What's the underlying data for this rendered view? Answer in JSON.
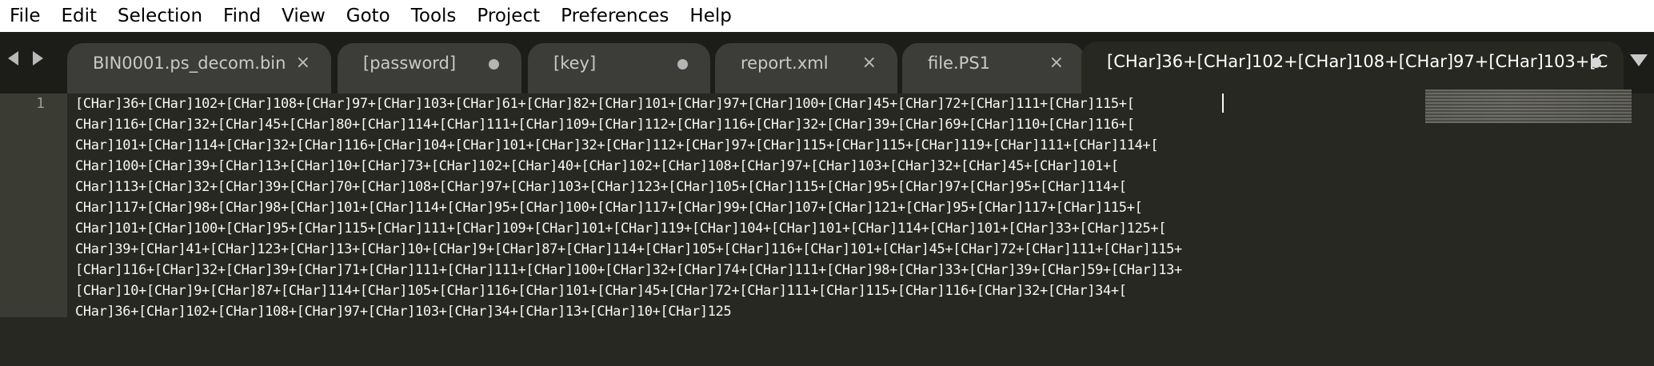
{
  "menu": [
    "File",
    "Edit",
    "Selection",
    "Find",
    "View",
    "Goto",
    "Tools",
    "Project",
    "Preferences",
    "Help"
  ],
  "tabs": [
    {
      "label": "BIN0001.ps_decom.bin",
      "indicator": "close",
      "close_glyph": "×",
      "active": false
    },
    {
      "label": "[password]",
      "indicator": "modified",
      "active": false
    },
    {
      "label": "[key]",
      "indicator": "modified",
      "active": false
    },
    {
      "label": "report.xml",
      "indicator": "close",
      "close_glyph": "×",
      "active": false
    },
    {
      "label": "file.PS1",
      "indicator": "close",
      "close_glyph": "×",
      "active": false
    },
    {
      "label": "[CHar]36+[CHar]102+[CHar]108+[CHar]97+[CHar]103+[C",
      "indicator": "modified",
      "active": true
    }
  ],
  "editor": {
    "line_number": "1",
    "lines": [
      "[CHar]36+[CHar]102+[CHar]108+[CHar]97+[CHar]103+[CHar]61+[CHar]82+[CHar]101+[CHar]97+[CHar]100+[CHar]45+[CHar]72+[CHar]111+[CHar]115+[",
      "CHar]116+[CHar]32+[CHar]45+[CHar]80+[CHar]114+[CHar]111+[CHar]109+[CHar]112+[CHar]116+[CHar]32+[CHar]39+[CHar]69+[CHar]110+[CHar]116+[",
      "CHar]101+[CHar]114+[CHar]32+[CHar]116+[CHar]104+[CHar]101+[CHar]32+[CHar]112+[CHar]97+[CHar]115+[CHar]115+[CHar]119+[CHar]111+[CHar]114+[",
      "CHar]100+[CHar]39+[CHar]13+[CHar]10+[CHar]73+[CHar]102+[CHar]40+[CHar]102+[CHar]108+[CHar]97+[CHar]103+[CHar]32+[CHar]45+[CHar]101+[",
      "CHar]113+[CHar]32+[CHar]39+[CHar]70+[CHar]108+[CHar]97+[CHar]103+[CHar]123+[CHar]105+[CHar]115+[CHar]95+[CHar]97+[CHar]95+[CHar]114+[",
      "CHar]117+[CHar]98+[CHar]98+[CHar]101+[CHar]114+[CHar]95+[CHar]100+[CHar]117+[CHar]99+[CHar]107+[CHar]121+[CHar]95+[CHar]117+[CHar]115+[",
      "CHar]101+[CHar]100+[CHar]95+[CHar]115+[CHar]111+[CHar]109+[CHar]101+[CHar]119+[CHar]104+[CHar]101+[CHar]114+[CHar]101+[CHar]33+[CHar]125+[",
      "CHar]39+[CHar]41+[CHar]123+[CHar]13+[CHar]10+[CHar]9+[CHar]87+[CHar]114+[CHar]105+[CHar]116+[CHar]101+[CHar]45+[CHar]72+[CHar]111+[CHar]115+",
      "[CHar]116+[CHar]32+[CHar]39+[CHar]71+[CHar]111+[CHar]111+[CHar]100+[CHar]32+[CHar]74+[CHar]111+[CHar]98+[CHar]33+[CHar]39+[CHar]59+[CHar]13+",
      "[CHar]10+[CHar]9+[CHar]87+[CHar]114+[CHar]105+[CHar]116+[CHar]101+[CHar]45+[CHar]72+[CHar]111+[CHar]115+[CHar]116+[CHar]32+[CHar]34+[",
      "CHar]36+[CHar]102+[CHar]108+[CHar]97+[CHar]103+[CHar]34+[CHar]13+[CHar]10+[CHar]125"
    ]
  },
  "icons": {
    "nav_left": "chevron-left-icon",
    "nav_right": "chevron-right-icon",
    "tab_overflow": "chevron-down-icon",
    "modified": "dot-icon",
    "close": "close-icon"
  },
  "colors": {
    "editor_bg": "#272822",
    "tabbar_bg": "#1c1d19",
    "tab_bg": "#3c3d38",
    "gutter_bg": "#3a3b33",
    "text": "#f8f8f2"
  }
}
